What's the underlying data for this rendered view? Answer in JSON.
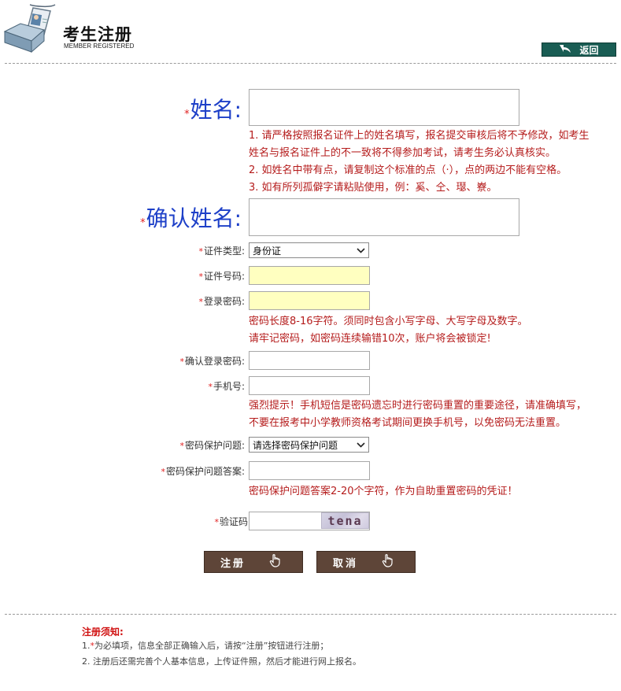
{
  "header": {
    "title": "考生注册",
    "subtitle": "MEMBER REGISTERED",
    "back_label": "返回"
  },
  "form": {
    "name": {
      "label": "姓名:",
      "hints": [
        "1. 请严格按照报名证件上的姓名填写，报名提交审核后将不予修改，如考生",
        "姓名与报名证件上的不一致将不得参加考试，请考生务必认真核实。",
        "2. 如姓名中带有点，请复制这个标准的点（·），点的两边不能有空格。",
        "3. 如有所列孤僻字请粘贴使用，例：奚、仝、璱、嶚。"
      ]
    },
    "confirm_name": {
      "label": "确认姓名:"
    },
    "id_type": {
      "label": "证件类型:",
      "selected": "身份证"
    },
    "id_number": {
      "label": "证件号码:"
    },
    "password": {
      "label": "登录密码:",
      "hints": [
        "密码长度8-16字符。须同时包含小写字母、大写字母及数字。",
        "请牢记密码，如密码连续输错10次，账户将会被锁定!"
      ]
    },
    "confirm_password": {
      "label": "确认登录密码:"
    },
    "mobile": {
      "label": "手机号:",
      "hints": [
        "强烈提示！手机短信是密码遗忘时进行密码重置的重要途径，请准确填写，",
        "不要在报考中小学教师资格考试期间更换手机号，以免密码无法重置。"
      ]
    },
    "security_question": {
      "label": "密码保护问题:",
      "selected": "请选择密码保护问题"
    },
    "security_answer": {
      "label": "密码保护问题答案:",
      "hint": "密码保护问题答案2-20个字符，作为自助重置密码的凭证！"
    },
    "captcha": {
      "label": "验证码",
      "image_text": "tena"
    }
  },
  "buttons": {
    "register": "注册",
    "cancel": "取消"
  },
  "notes": {
    "title": "注册须知:",
    "items": [
      {
        "num": "1.",
        "text": "为必填项，信息全部正确输入后，请按“注册”按钮进行注册；"
      },
      {
        "num": "2.",
        "text": "注册后还需完善个人基本信息，上传证件照，然后才能进行网上报名。"
      }
    ]
  },
  "icons": {
    "logo": "id-badge-icon",
    "back": "back-arrow-icon",
    "pointer": "hand-pointer-icon",
    "chevron": "chevron-down-icon"
  },
  "colors": {
    "accent_green": "#1a5d54",
    "button_brown": "#5e4538",
    "hint_red": "#b51c1c",
    "label_blue": "#1e40c8",
    "required_star": "#e02020",
    "input_yellow": "#ffffc0"
  }
}
